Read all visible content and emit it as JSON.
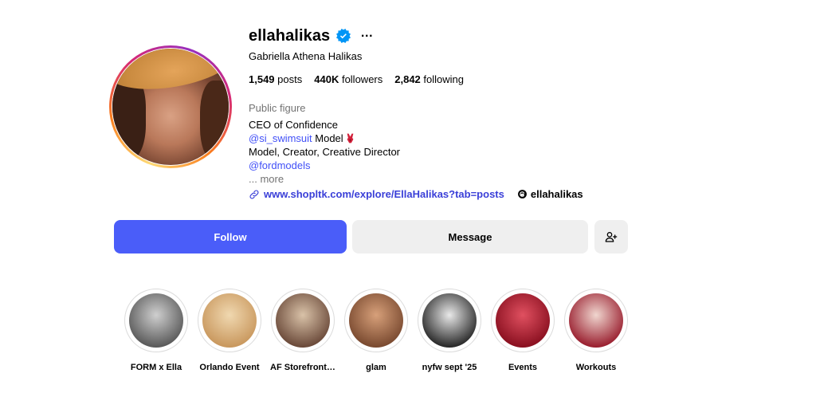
{
  "profile": {
    "username": "ellahalikas",
    "full_name": "Gabriella Athena Halikas",
    "verified_icon": "verified-badge-icon",
    "more_icon": "…",
    "stats": {
      "posts_count": "1,549",
      "posts_label": "posts",
      "followers_count": "440K",
      "followers_label": "followers",
      "following_count": "2,842",
      "following_label": "following"
    },
    "category": "Public figure",
    "bio": {
      "line1": "CEO of Confidence",
      "mention1": "@si_swimsuit",
      "line2_text": " Model",
      "line3": "Model, Creator, Creative Director",
      "mention2": "@fordmodels",
      "more": "... more"
    },
    "link": "www.shopltk.com/explore/EllaHalikas?tab=posts",
    "threads_handle": "ellahalikas"
  },
  "actions": {
    "follow_label": "Follow",
    "message_label": "Message",
    "suggest_icon": "add-person-icon"
  },
  "highlights": [
    {
      "label": "FORM x Ella",
      "colors": [
        "#5a5a5a",
        "#cfcfcf"
      ]
    },
    {
      "label": "Orlando Event",
      "colors": [
        "#c9985e",
        "#f0d8b0"
      ]
    },
    {
      "label": "AF Storefront…",
      "colors": [
        "#6b4a3a",
        "#d9c2a8"
      ]
    },
    {
      "label": "glam",
      "colors": [
        "#7a4a30",
        "#d7a07a"
      ]
    },
    {
      "label": "nyfw sept '25",
      "colors": [
        "#2a2a2a",
        "#e9e9e9"
      ]
    },
    {
      "label": "Events",
      "colors": [
        "#8a1020",
        "#e05060"
      ]
    },
    {
      "label": "Workouts",
      "colors": [
        "#9a2030",
        "#f0d6cf"
      ]
    }
  ],
  "colors": {
    "follow_button": "#4a5df9",
    "link": "#3a3fd8",
    "mention": "#4150f7",
    "verified": "#0095f6"
  }
}
